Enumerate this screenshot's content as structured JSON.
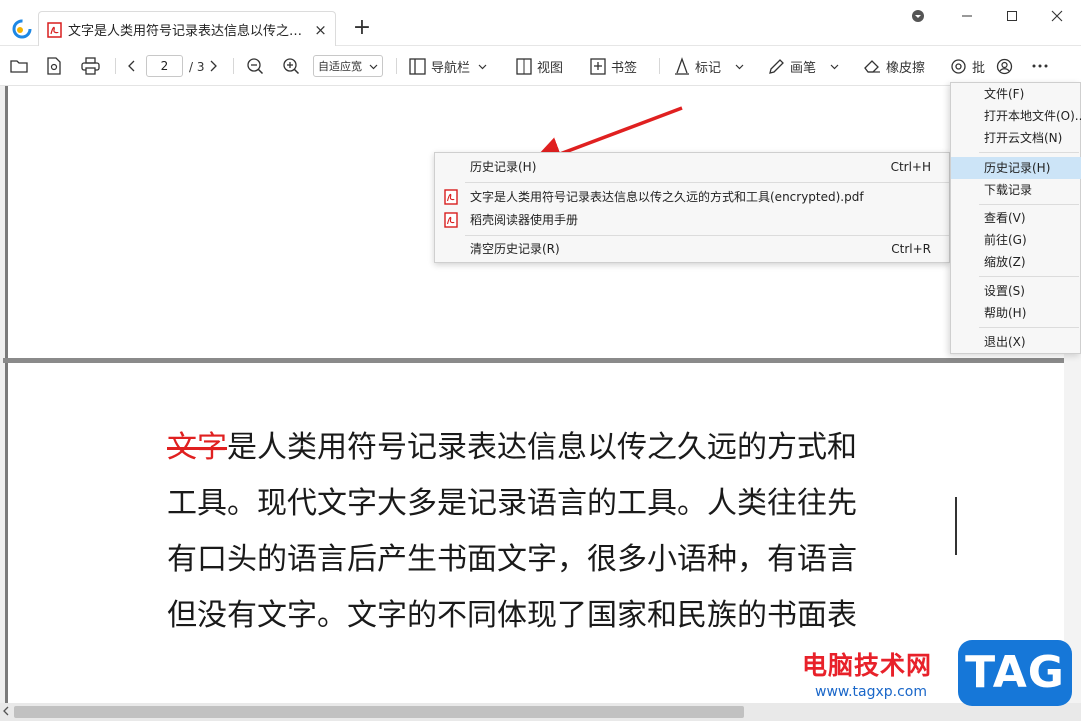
{
  "window": {
    "tab_title": "文字是人类用符号记录表达信息以传之久远...",
    "tab_close": "×",
    "new_tab": "+"
  },
  "toolbar": {
    "page_current": "2",
    "page_total": "/ 3",
    "zoom_value": "自适应宽",
    "nav_label": "导航栏",
    "view_label": "视图",
    "bookmark_label": "书签",
    "mark_label": "标记",
    "pen_label": "画笔",
    "eraser_label": "橡皮擦",
    "review_label": "批"
  },
  "main_menu": {
    "items": [
      {
        "label": "文件(F)"
      },
      {
        "label": "打开本地文件(O)..."
      },
      {
        "label": "打开云文档(N)"
      },
      {
        "label": "历史记录(H)"
      },
      {
        "label": "下载记录"
      },
      {
        "label": "查看(V)"
      },
      {
        "label": "前往(G)"
      },
      {
        "label": "缩放(Z)"
      },
      {
        "label": "设置(S)"
      },
      {
        "label": "帮助(H)"
      },
      {
        "label": "退出(X)"
      }
    ]
  },
  "history_menu": {
    "header_label": "历史记录(H)",
    "header_shortcut": "Ctrl+H",
    "files": [
      {
        "label": "文字是人类用符号记录表达信息以传之久远的方式和工具(encrypted).pdf"
      },
      {
        "label": "稻壳阅读器使用手册"
      }
    ],
    "clear_label": "清空历史记录(R)",
    "clear_shortcut": "Ctrl+R"
  },
  "document": {
    "struck_word": "文字",
    "line1_rest": "是人类用符号记录表达信息以传之久远的方式和",
    "line2": "工具。现代文字大多是记录语言的工具。人类往往先",
    "line3": "有口头的语言后产生书面文字，很多小语种，有语言",
    "line4": "但没有文字。文字的不同体现了国家和民族的书面表"
  },
  "watermark": {
    "site_name": "电脑技术网",
    "url": "www.tagxp.com",
    "tag": "TAG"
  },
  "colors": {
    "accent_highlight": "#cce4f7",
    "annotation_red": "#e02020",
    "pdf_red": "#d81e1e",
    "watermark_blue": "#1677d8"
  }
}
